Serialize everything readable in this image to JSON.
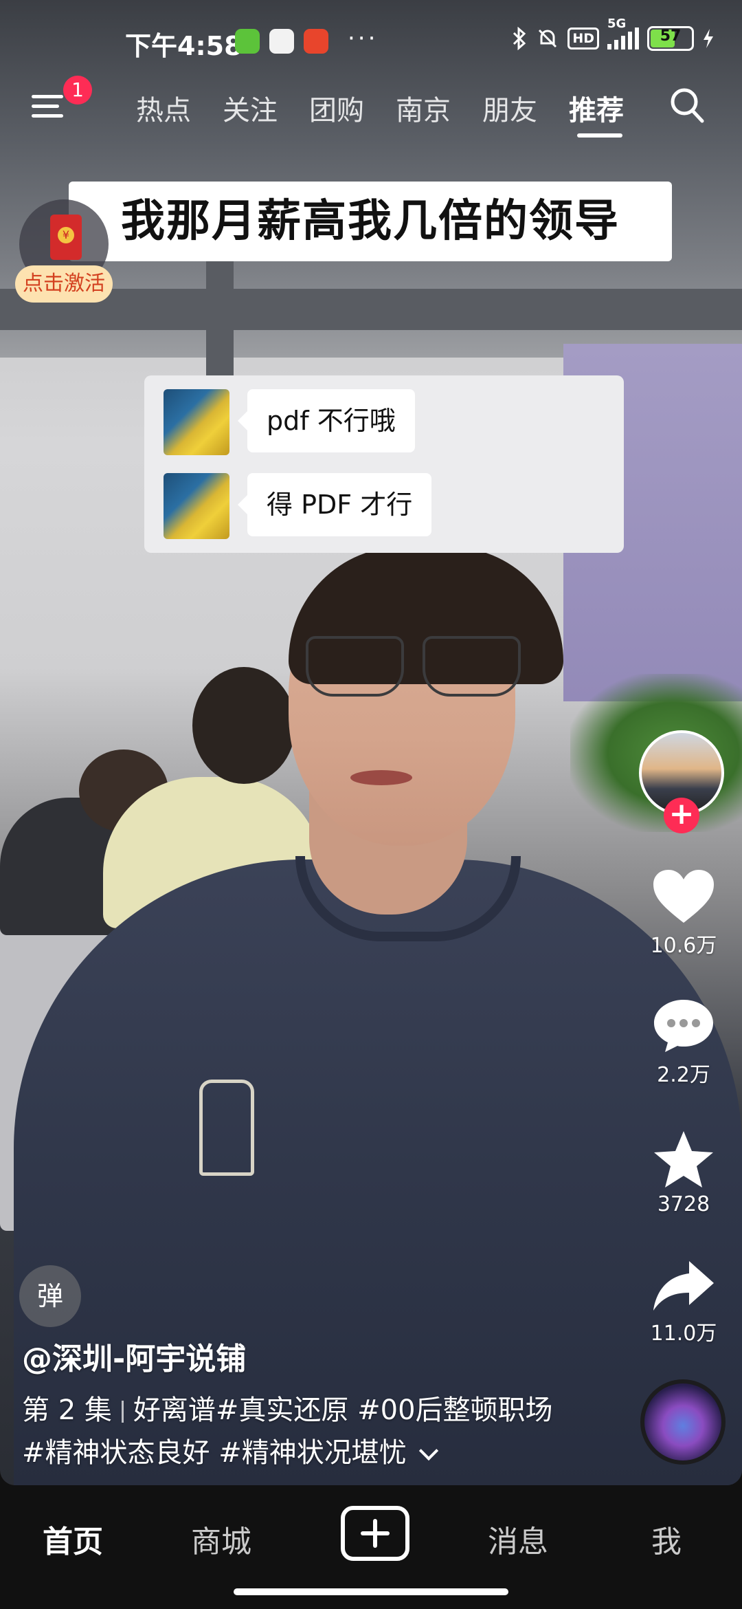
{
  "status_bar": {
    "time": "下午4:58",
    "network": "5G",
    "hd_label": "HD",
    "battery": "57",
    "overflow_dots": "···"
  },
  "top_nav": {
    "notification_count": "1",
    "tabs": [
      {
        "label": "热点"
      },
      {
        "label": "关注"
      },
      {
        "label": "团购"
      },
      {
        "label": "南京"
      },
      {
        "label": "朋友"
      },
      {
        "label": "推荐",
        "active": true
      }
    ]
  },
  "video": {
    "caption_banner": "我那月薪高我几倍的领导",
    "chat_messages": [
      {
        "text": "pdf 不行哦"
      },
      {
        "text": "得 PDF 才行"
      }
    ]
  },
  "red_packet": {
    "label": "点击激活"
  },
  "actions": {
    "likes": "10.6万",
    "comments": "2.2万",
    "favorites": "3728",
    "shares": "11.0万",
    "follow_symbol": "+"
  },
  "danmaku": {
    "label": "弹"
  },
  "description": {
    "author": "@深圳-阿宇说铺",
    "episode": "第 2 集",
    "line1": "好离谱#真实还原 #00后整顿职场",
    "line2": "#精神状态良好 #精神状况堪忧"
  },
  "bottom_nav": {
    "items": [
      {
        "label": "首页",
        "active": true
      },
      {
        "label": "商城"
      },
      {
        "label": "消息"
      },
      {
        "label": "我"
      }
    ]
  },
  "colors": {
    "accent_red": "#fe2c55",
    "battery_green": "#7ee04a",
    "activate_bg": "#fde2b0"
  }
}
